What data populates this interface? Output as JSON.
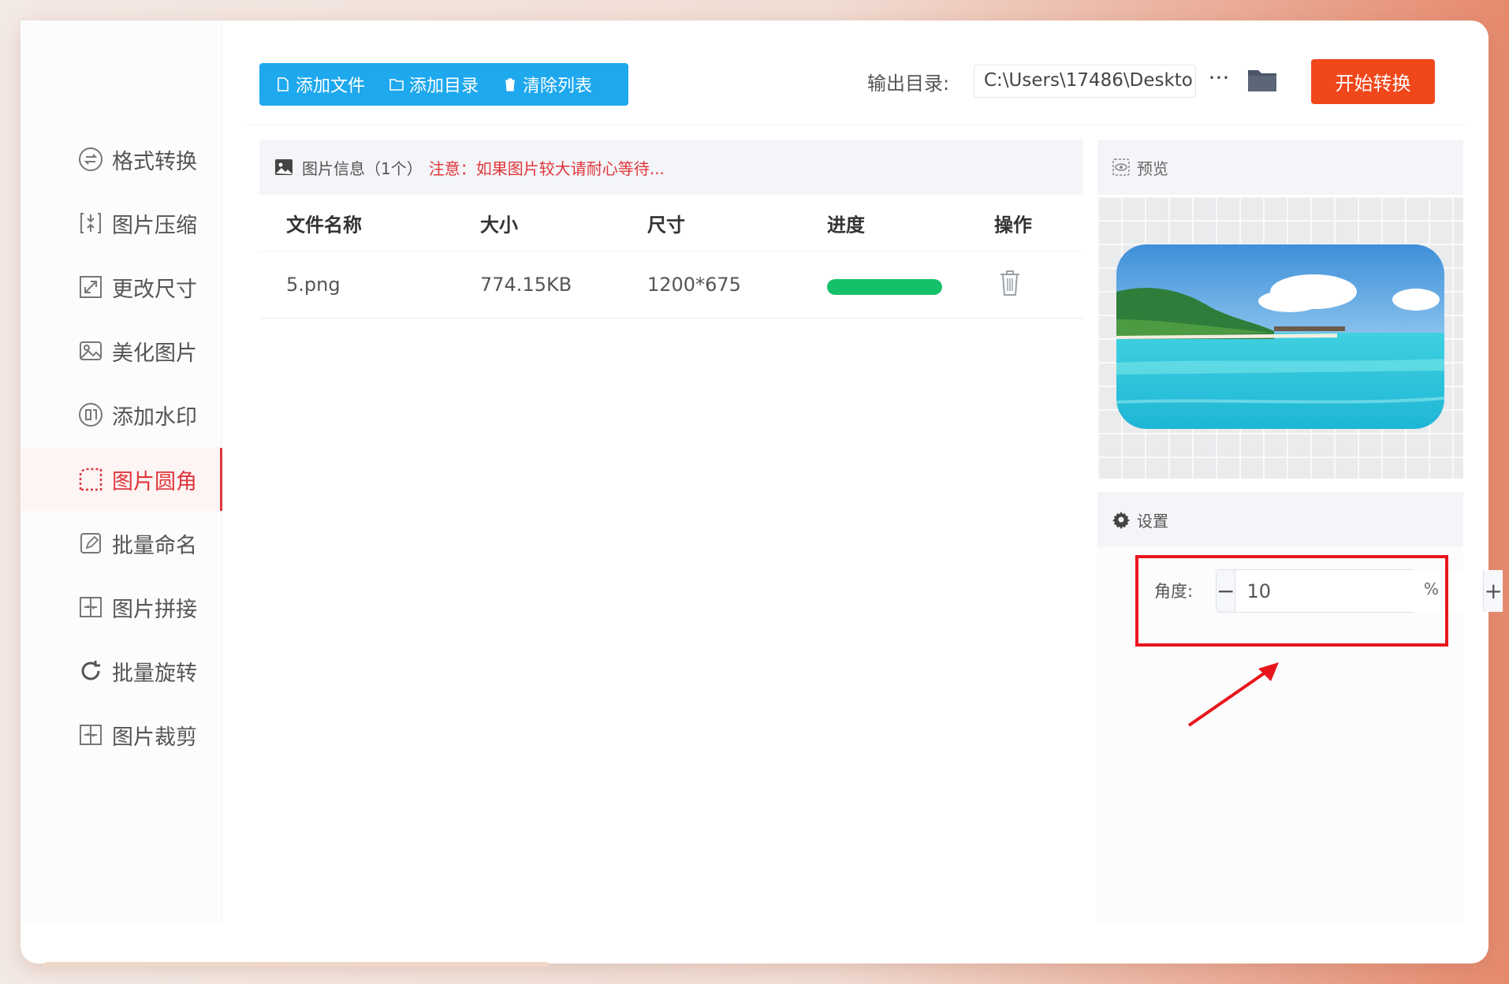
{
  "sidebar": {
    "items": [
      {
        "label": "格式转换",
        "icon": "format-convert-icon"
      },
      {
        "label": "图片压缩",
        "icon": "compress-icon"
      },
      {
        "label": "更改尺寸",
        "icon": "resize-icon"
      },
      {
        "label": "美化图片",
        "icon": "beautify-icon"
      },
      {
        "label": "添加水印",
        "icon": "watermark-icon"
      },
      {
        "label": "图片圆角",
        "icon": "round-corner-icon",
        "active": true
      },
      {
        "label": "批量命名",
        "icon": "rename-icon"
      },
      {
        "label": "图片拼接",
        "icon": "stitch-icon"
      },
      {
        "label": "批量旋转",
        "icon": "rotate-icon"
      },
      {
        "label": "图片裁剪",
        "icon": "crop-icon"
      }
    ]
  },
  "toolbar": {
    "add_file": "添加文件",
    "add_folder": "添加目录",
    "clear_list": "清除列表",
    "output_label": "输出目录:",
    "output_path": "C:\\Users\\17486\\Deskto",
    "more": "···",
    "start": "开始转换"
  },
  "file_panel": {
    "info_title": "图片信息（1个）",
    "note": "注意：如果图片较大请耐心等待...",
    "columns": [
      "文件名称",
      "大小",
      "尺寸",
      "进度",
      "操作"
    ],
    "rows": [
      {
        "name": "5.png",
        "size": "774.15KB",
        "dimensions": "1200*675",
        "progress": 1.0
      }
    ]
  },
  "preview": {
    "title": "预览"
  },
  "settings": {
    "title": "设置",
    "angle_label": "角度:",
    "angle_value": "10",
    "minus": "−",
    "plus": "+",
    "unit": "%"
  },
  "colors": {
    "accent_blue": "#1ea8ee",
    "start_orange": "#f0471b",
    "active_red": "#e0363b",
    "progress_green": "#16c06a",
    "highlight_red": "#e8161c"
  }
}
